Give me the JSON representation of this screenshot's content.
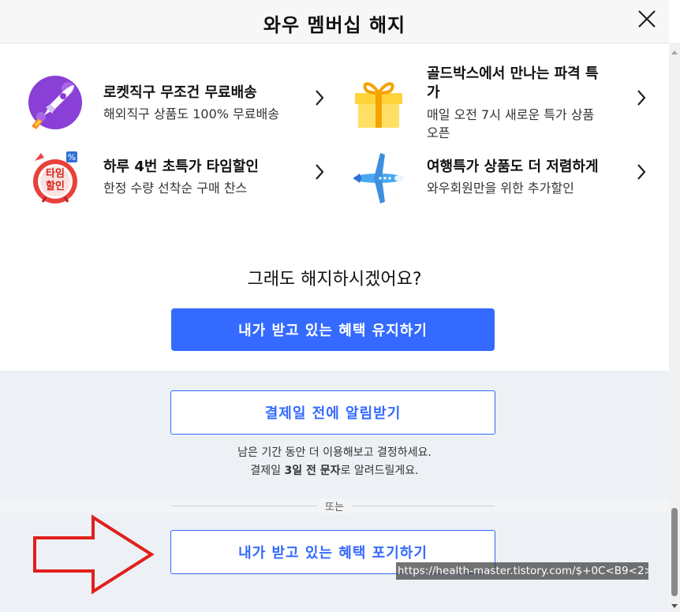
{
  "header": {
    "title": "와우 멤버십 해지",
    "close_icon": "close-icon"
  },
  "benefits": [
    {
      "icon": "rocket-icon",
      "title": "로켓직구 무조건 무료배송",
      "desc": "해외직구 상품도 100% 무료배송"
    },
    {
      "icon": "gift-box-icon",
      "title_line1": "골드박스에서 만나는 파격 특",
      "title_line2": "가",
      "desc_line1": "매일 오전 7시 새로운 특가 상품",
      "desc_line2": "오픈"
    },
    {
      "icon": "timer-sale-icon",
      "badge_line1": "타임",
      "badge_line2": "할인",
      "title": "하루 4번 초특가 타임할인",
      "desc": "한정 수량 선착순 구매 찬스"
    },
    {
      "icon": "airplane-icon",
      "title": "여행특가 상품도 더 저렴하게",
      "desc": "와우회원만을 위한 추가할인"
    }
  ],
  "question": "그래도 해지하시겠어요?",
  "keep_button": "내가 받고 있는 혜택 유지하기",
  "notify_button": "결제일 전에 알림받기",
  "notify_note_line1": "남은 기간 동안 더 이용해보고 결정하세요.",
  "notify_note_line2_a": "결제일 ",
  "notify_note_line2_b": "3일 전 문자",
  "notify_note_line2_c": "로 알려드릴게요.",
  "or_label": "또는",
  "give_up_button": "내가 받고 있는 혜택 포기하기",
  "watermark": "https://health-master.tistory.com/$+0C<B9<2>",
  "colors": {
    "primary": "#346aff",
    "arrow_red": "#e0201b"
  }
}
